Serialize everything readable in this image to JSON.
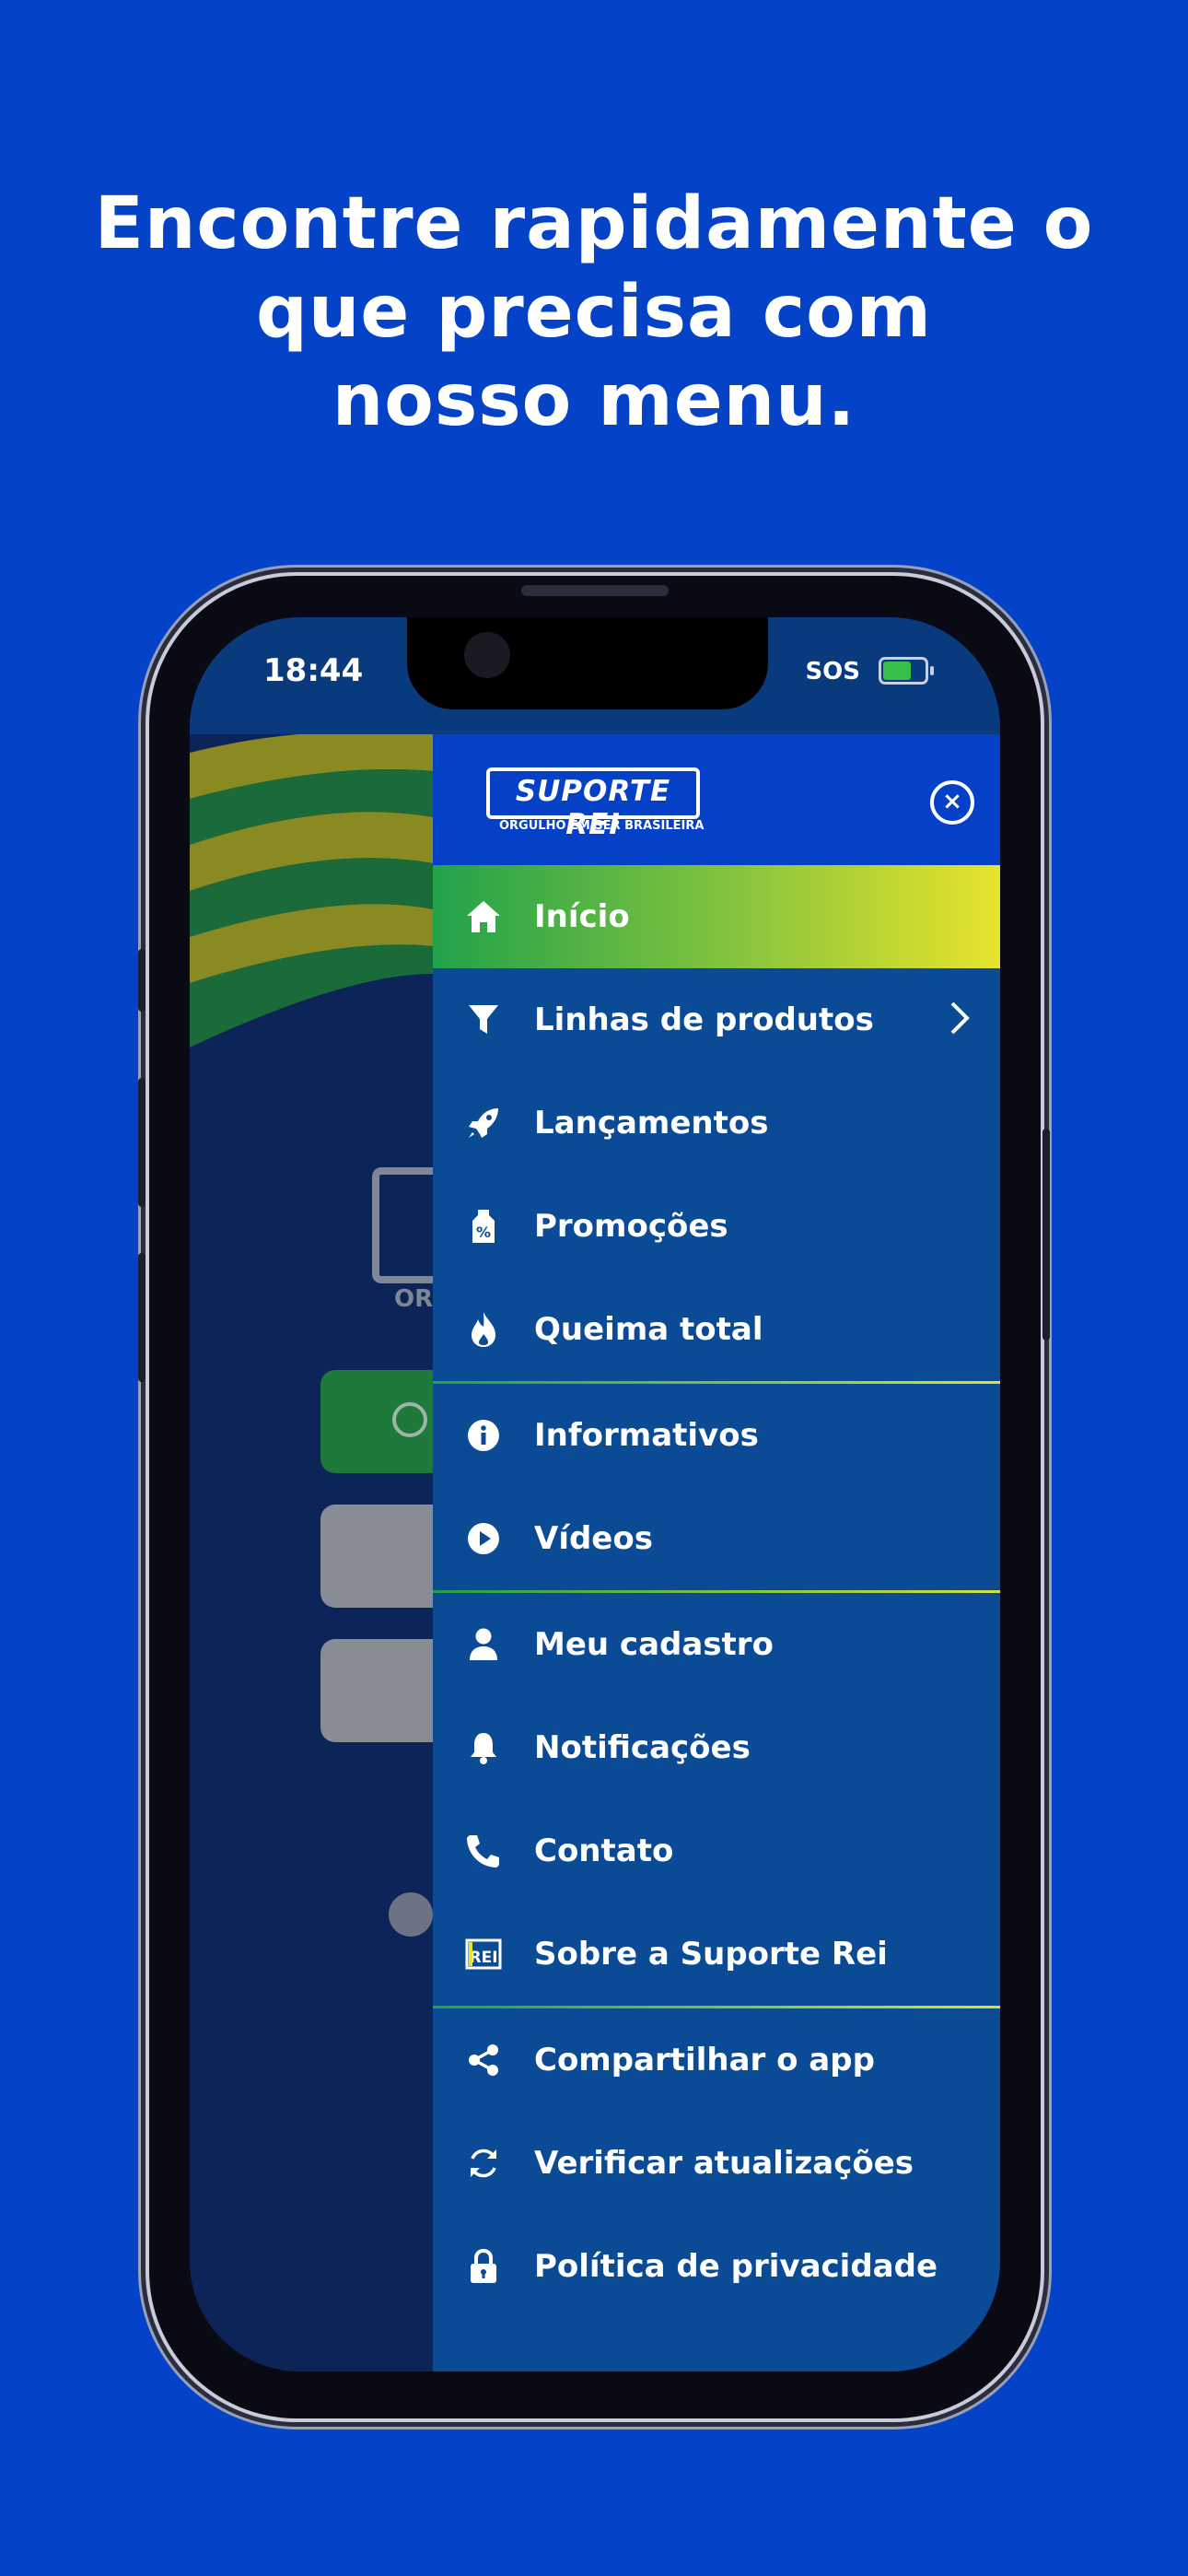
{
  "headline": {
    "line1": "Encontre rapidamente o",
    "line2": "que precisa com",
    "line3": "nosso menu."
  },
  "status_bar": {
    "time": "18:44",
    "sos": "SOS"
  },
  "background_app": {
    "logo_text_partial": "OR"
  },
  "drawer": {
    "brand_name": "SUPORTE REI",
    "brand_tagline": "ORGULHO EM SER BRASILEIRA",
    "close_icon": "×",
    "items": [
      {
        "label": "Início",
        "icon": "home-icon",
        "active": true
      },
      {
        "label": "Linhas de produtos",
        "icon": "filter-icon",
        "has_submenu": true
      },
      {
        "label": "Lançamentos",
        "icon": "rocket-icon"
      },
      {
        "label": "Promoções",
        "icon": "price-tag-icon"
      },
      {
        "label": "Queima total",
        "icon": "fire-icon"
      },
      {
        "label": "Informativos",
        "icon": "info-icon"
      },
      {
        "label": "Vídeos",
        "icon": "play-icon"
      },
      {
        "label": "Meu cadastro",
        "icon": "user-icon"
      },
      {
        "label": "Notificações",
        "icon": "bell-icon"
      },
      {
        "label": "Contato",
        "icon": "phone-icon"
      },
      {
        "label": "Sobre a Suporte Rei",
        "icon": "rei-logo-icon"
      },
      {
        "label": "Compartilhar o app",
        "icon": "share-icon"
      },
      {
        "label": "Verificar atualizações",
        "icon": "refresh-icon"
      },
      {
        "label": "Política de privacidade",
        "icon": "lock-icon"
      }
    ]
  },
  "colors": {
    "page_background": "#0442c7",
    "drawer_background": "#0b4b96",
    "active_gradient_start": "#22a24a",
    "active_gradient_end": "#e8e42c"
  }
}
